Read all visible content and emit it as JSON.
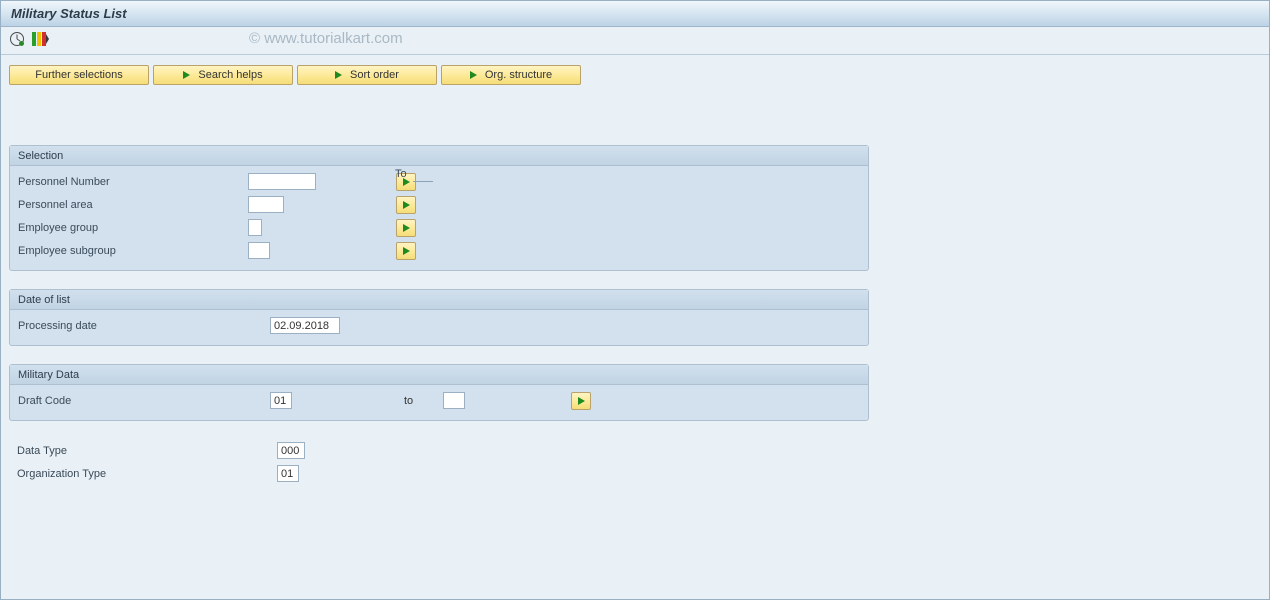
{
  "title": "Military Status List",
  "watermark": "© www.tutorialkart.com",
  "toolbar": {
    "buttons": {
      "further": "Further selections",
      "search": "Search helps",
      "sort": "Sort order",
      "org": "Org. structure"
    }
  },
  "labels": {
    "to_header": "To"
  },
  "selection": {
    "header": "Selection",
    "fields": {
      "personnel_number": {
        "label": "Personnel Number",
        "value": ""
      },
      "personnel_area": {
        "label": "Personnel area",
        "value": ""
      },
      "employee_group": {
        "label": "Employee group",
        "value": ""
      },
      "employee_subgroup": {
        "label": "Employee subgroup",
        "value": ""
      }
    }
  },
  "date_of_list": {
    "header": "Date of list",
    "processing_date": {
      "label": "Processing date",
      "value": "02.09.2018"
    }
  },
  "military_data": {
    "header": "Military Data",
    "draft_code": {
      "label": "Draft Code",
      "value": "01",
      "to_label": "to",
      "to_value": ""
    }
  },
  "misc": {
    "data_type": {
      "label": "Data Type",
      "value": "000"
    },
    "organization_type": {
      "label": "Organization Type",
      "value": "01"
    }
  }
}
